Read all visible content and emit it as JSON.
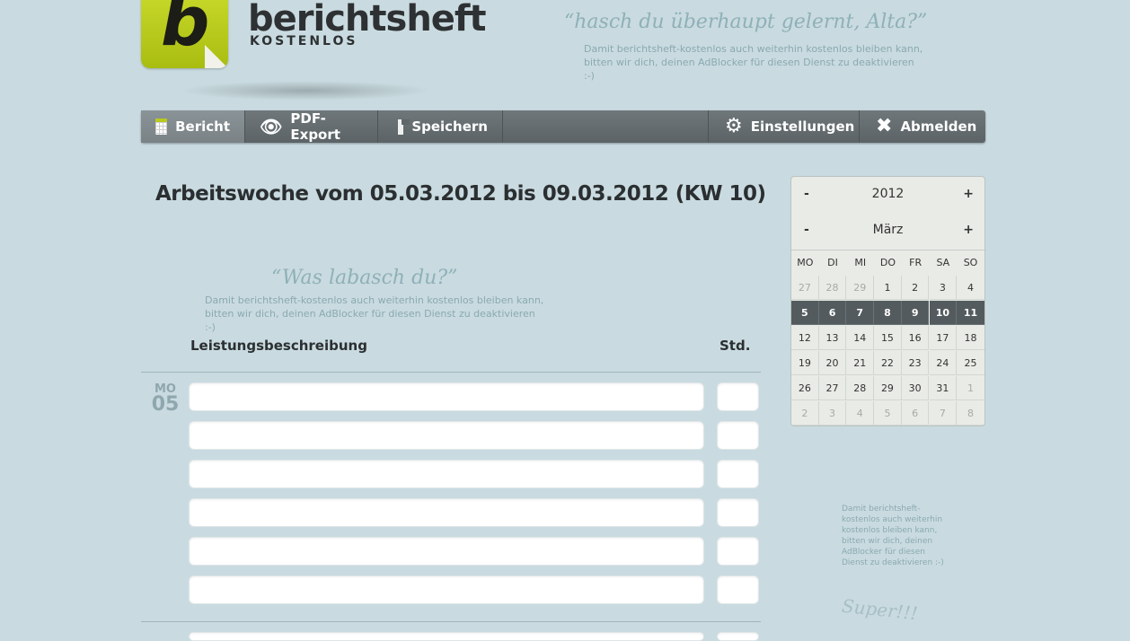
{
  "header": {
    "logo_letter": "b",
    "brand_name": "berichtsheft",
    "brand_sub": "KOSTENLOS",
    "quote": "“hasch du überhaupt gelernt, Alta?”",
    "adblock_text": "Damit berichtsheft-kostenlos auch weiterhin kostenlos bleiben kann, bitten wir dich, deinen AdBlocker für diesen Dienst zu deaktivieren :-)"
  },
  "nav": {
    "items": [
      {
        "label": "Bericht",
        "icon": "calendar-icon"
      },
      {
        "label": "PDF-Export",
        "icon": "eye-icon"
      },
      {
        "label": "Speichern",
        "icon": "floppy-disk-icon"
      }
    ],
    "right_items": [
      {
        "label": "Einstellungen",
        "icon": "gear-icon"
      },
      {
        "label": "Abmelden",
        "icon": "close-icon"
      }
    ]
  },
  "main": {
    "title": "Arbeitswoche vom 05.03.2012 bis 09.03.2012 (KW 10)",
    "quote": "“Was labasch du?”",
    "adblock_text": "Damit berichtsheft-kostenlos auch weiterhin kostenlos bleiben kann, bitten wir dich, deinen AdBlocker für diesen Dienst zu deaktivieren :-)",
    "col_description": "Leistungsbeschreibung",
    "col_hours": "Std.",
    "days": [
      {
        "day_name": "MO",
        "day_num": "05",
        "rows": [
          "",
          "",
          "",
          "",
          "",
          ""
        ]
      }
    ]
  },
  "calendar": {
    "year_minus": "-",
    "year": "2012",
    "year_plus": "+",
    "month_minus": "-",
    "month": "März",
    "month_plus": "+",
    "weekdays": [
      "MO",
      "DI",
      "MI",
      "DO",
      "FR",
      "SA",
      "SO"
    ],
    "weeks": [
      [
        {
          "d": "27",
          "o": true
        },
        {
          "d": "28",
          "o": true
        },
        {
          "d": "29",
          "o": true
        },
        {
          "d": "1"
        },
        {
          "d": "2"
        },
        {
          "d": "3"
        },
        {
          "d": "4"
        }
      ],
      [
        {
          "d": "5",
          "s": true
        },
        {
          "d": "6",
          "s": true
        },
        {
          "d": "7",
          "s": true
        },
        {
          "d": "8",
          "s": true
        },
        {
          "d": "9",
          "s": true
        },
        {
          "d": "10",
          "s": true
        },
        {
          "d": "11",
          "s": true
        }
      ],
      [
        {
          "d": "12"
        },
        {
          "d": "13"
        },
        {
          "d": "14"
        },
        {
          "d": "15"
        },
        {
          "d": "16"
        },
        {
          "d": "17"
        },
        {
          "d": "18"
        }
      ],
      [
        {
          "d": "19"
        },
        {
          "d": "20"
        },
        {
          "d": "21"
        },
        {
          "d": "22"
        },
        {
          "d": "23"
        },
        {
          "d": "24"
        },
        {
          "d": "25"
        }
      ],
      [
        {
          "d": "26"
        },
        {
          "d": "27"
        },
        {
          "d": "28"
        },
        {
          "d": "29"
        },
        {
          "d": "30"
        },
        {
          "d": "31"
        },
        {
          "d": "1",
          "o": true
        }
      ],
      [
        {
          "d": "2",
          "o": true
        },
        {
          "d": "3",
          "o": true
        },
        {
          "d": "4",
          "o": true
        },
        {
          "d": "5",
          "o": true
        },
        {
          "d": "6",
          "o": true
        },
        {
          "d": "7",
          "o": true
        },
        {
          "d": "8",
          "o": true
        }
      ]
    ]
  },
  "sidebar": {
    "adblock_text": "Damit berichtsheft-kostenlos auch weiterhin kostenlos bleiben kann, bitten wir dich, deinen AdBlocker für diesen Dienst zu deaktivieren :-)",
    "quote": "Super!!!"
  }
}
